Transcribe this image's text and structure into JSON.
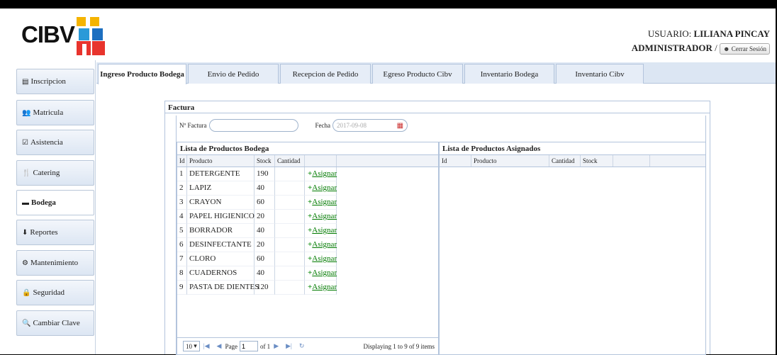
{
  "header": {
    "logo_text": "CIBV",
    "user_label": "USUARIO:",
    "user_name": "LILIANA PINCAY",
    "role": "ADMINISTRADOR",
    "separator": "/",
    "logout_label": "Cerrar Sesión"
  },
  "sidebar": {
    "items": [
      {
        "icon": "▤",
        "label": "Inscripcion"
      },
      {
        "icon": "👥",
        "label": "Matricula"
      },
      {
        "icon": "☑",
        "label": "Asistencia"
      },
      {
        "icon": "🍴",
        "label": "Catering"
      },
      {
        "icon": "▬",
        "label": "Bodega"
      },
      {
        "icon": "⬇",
        "label": "Reportes"
      },
      {
        "icon": "⚙",
        "label": "Mantenimiento"
      },
      {
        "icon": "🔒",
        "label": "Seguridad"
      },
      {
        "icon": "🔍",
        "label": "Cambiar Clave"
      }
    ],
    "active": "Bodega"
  },
  "tabs": [
    {
      "label": "Ingreso Producto Bodega"
    },
    {
      "label": "Envio de Pedido"
    },
    {
      "label": "Recepcion de Pedido"
    },
    {
      "label": "Egreso Producto Cibv"
    },
    {
      "label": "Inventario Bodega"
    },
    {
      "label": "Inventario Cibv"
    }
  ],
  "panel": {
    "title": "Factura",
    "factura_label": "Nº Factura",
    "factura_value": "",
    "fecha_label": "Fecha",
    "fecha_value": "2017-09-08"
  },
  "left_grid": {
    "title": "Lista de Productos Bodega",
    "columns": [
      "Id",
      "Producto",
      "Stock",
      "Cantidad"
    ],
    "action_label": "Asignar",
    "rows": [
      {
        "id": "1",
        "producto": "DETERGENTE",
        "stock": "190"
      },
      {
        "id": "2",
        "producto": "LAPIZ",
        "stock": "40"
      },
      {
        "id": "3",
        "producto": "CRAYON",
        "stock": "60"
      },
      {
        "id": "4",
        "producto": "PAPEL HIGIENICO",
        "stock": "20"
      },
      {
        "id": "5",
        "producto": "BORRADOR",
        "stock": "40"
      },
      {
        "id": "6",
        "producto": "DESINFECTANTE",
        "stock": "20"
      },
      {
        "id": "7",
        "producto": "CLORO",
        "stock": "60"
      },
      {
        "id": "8",
        "producto": "CUADERNOS",
        "stock": "40"
      },
      {
        "id": "9",
        "producto": "PASTA DE DIENTES",
        "stock": "120"
      }
    ],
    "pager": {
      "page_size": "10",
      "page_label": "Page",
      "page_value": "1",
      "of_label": "of 1",
      "display_text": "Displaying 1 to 9 of 9 items"
    }
  },
  "right_grid": {
    "title": "Lista de Productos Asignados",
    "columns": [
      "Id",
      "Producto",
      "Cantidad",
      "Stock"
    ]
  }
}
